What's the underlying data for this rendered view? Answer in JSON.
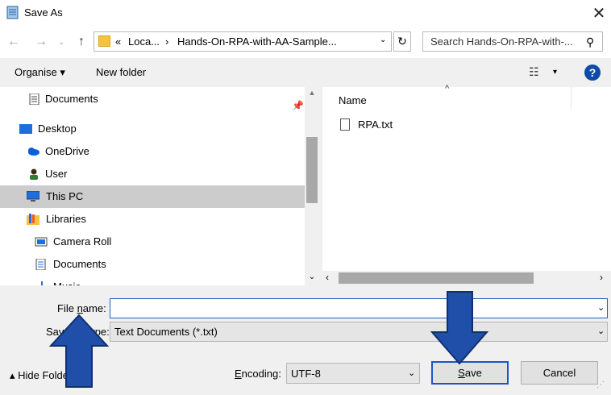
{
  "window": {
    "title": "Save As",
    "close_glyph": "✕"
  },
  "nav": {
    "back_glyph": "←",
    "forward_glyph": "→",
    "recent_glyph": "⌄",
    "up_glyph": "↑",
    "address": {
      "overflow_glyph": "«",
      "crumb1": "Loca...",
      "sep": "›",
      "crumb2": "Hands-On-RPA-with-AA-Sample...",
      "dropdown_glyph": "⌄"
    },
    "refresh_glyph": "↻",
    "search_placeholder": "Search Hands-On-RPA-with-...",
    "search_glyph": "⚲"
  },
  "toolbar": {
    "organise_label": "Organise ▾",
    "new_folder_label": "New folder",
    "view_glyph": "☷",
    "view_dd_glyph": "▾",
    "help_glyph": "?"
  },
  "sidebar": {
    "pin_glyph": "📌",
    "items": [
      {
        "label": "Documents",
        "icon": "documents-icon"
      },
      {
        "label": "Desktop",
        "icon": "desktop-icon"
      },
      {
        "label": "OneDrive",
        "icon": "cloud-icon"
      },
      {
        "label": "User",
        "icon": "user-icon"
      },
      {
        "label": "This PC",
        "icon": "computer-icon",
        "selected": true
      },
      {
        "label": "Libraries",
        "icon": "libraries-icon"
      },
      {
        "label": "Camera Roll",
        "icon": "camera-roll-icon"
      },
      {
        "label": "Documents",
        "icon": "documents-icon"
      },
      {
        "label": "Music",
        "icon": "music-icon"
      }
    ],
    "scroll_up_glyph": "▲",
    "scroll_down_glyph": "⌄"
  },
  "filelist": {
    "sort_glyph": "^",
    "column_name": "Name",
    "files": [
      {
        "name": "RPA.txt",
        "icon": "text-file-icon"
      }
    ],
    "hscroll_left_glyph": "‹",
    "hscroll_right_glyph": "›"
  },
  "form": {
    "filename_label_pre": "File ",
    "filename_label_u": "n",
    "filename_label_post": "ame:",
    "filename_value": "",
    "filename_dd_glyph": "⌄",
    "savetype_label": "Save as type:",
    "savetype_value": "Text Documents (*.txt)",
    "savetype_dd_glyph": "⌄",
    "hide_folders_label": "▴  Hide Folders",
    "encoding_label_pre": "",
    "encoding_label_u": "E",
    "encoding_label_post": "ncoding:",
    "encoding_value": "UTF-8",
    "encoding_dd_glyph": "⌄",
    "save_u": "S",
    "save_rest": "ave",
    "cancel_label": "Cancel",
    "grip_glyph": "⋰"
  },
  "colors": {
    "accent": "#1a55c8",
    "selected_bg": "#cccccc",
    "annotation_arrow": "#1f4fa8"
  }
}
